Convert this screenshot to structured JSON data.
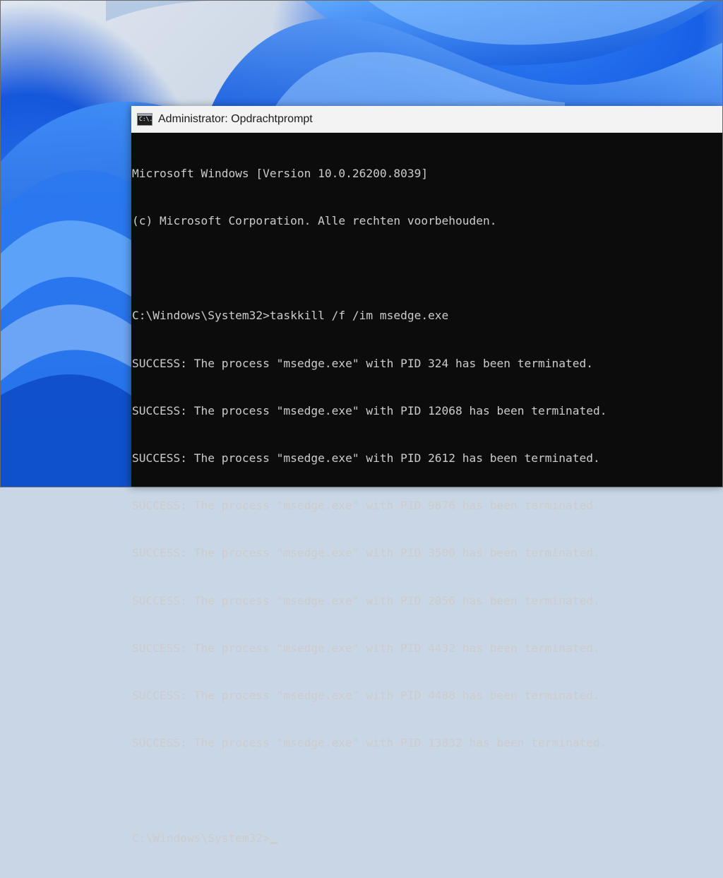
{
  "window": {
    "title": "Administrator: Opdrachtprompt",
    "icon": "cmd-icon",
    "icon_text": "C:\\."
  },
  "console": {
    "header": [
      "Microsoft Windows [Version 10.0.26200.8039]",
      "(c) Microsoft Corporation. Alle rechten voorbehouden."
    ],
    "command": "C:\\Windows\\System32>taskkill /f /im msedge.exe",
    "results": [
      "SUCCESS: The process \"msedge.exe\" with PID 324 has been terminated.",
      "SUCCESS: The process \"msedge.exe\" with PID 12068 has been terminated.",
      "SUCCESS: The process \"msedge.exe\" with PID 2612 has been terminated.",
      "SUCCESS: The process \"msedge.exe\" with PID 9876 has been terminated.",
      "SUCCESS: The process \"msedge.exe\" with PID 3500 has been terminated.",
      "SUCCESS: The process \"msedge.exe\" with PID 2056 has been terminated.",
      "SUCCESS: The process \"msedge.exe\" with PID 4432 has been terminated.",
      "SUCCESS: The process \"msedge.exe\" with PID 4488 has been terminated.",
      "SUCCESS: The process \"msedge.exe\" with PID 13832 has been terminated."
    ],
    "prompt": "C:\\Windows\\System32>"
  },
  "colors": {
    "console_bg": "#0c0c0c",
    "console_text": "#cccccc",
    "titlebar_bg": "#f3f3f3",
    "wallpaper_blue": "#1760e6"
  }
}
